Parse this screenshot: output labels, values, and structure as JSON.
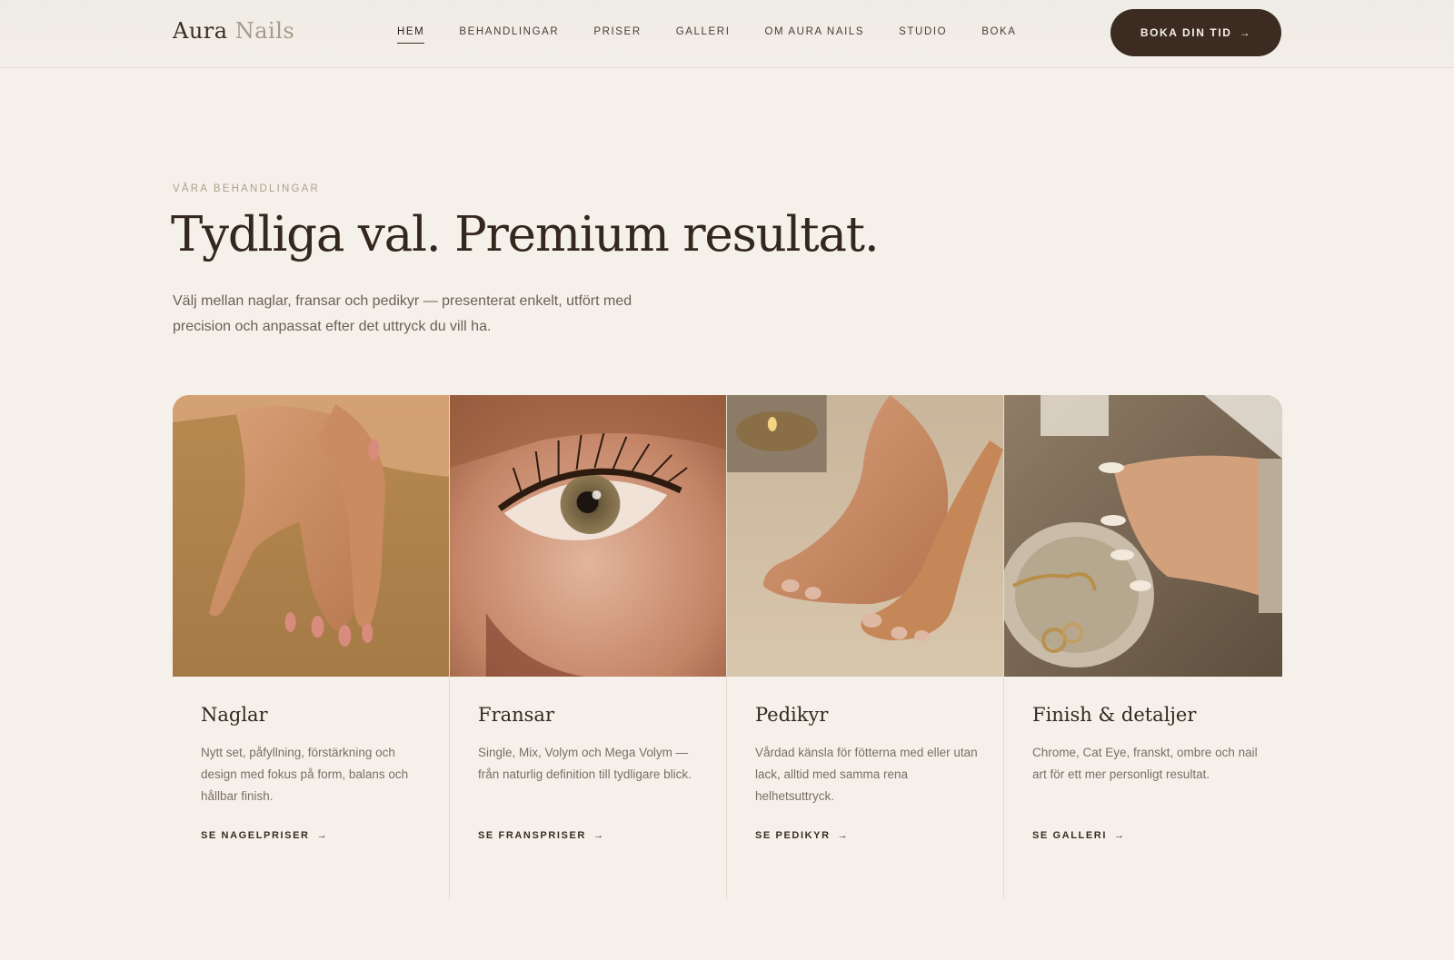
{
  "brand": {
    "name_primary": "Aura",
    "name_secondary": "Nails"
  },
  "nav": {
    "items": [
      {
        "label": "HEM",
        "active": true
      },
      {
        "label": "BEHANDLINGAR"
      },
      {
        "label": "PRISER"
      },
      {
        "label": "GALLERI"
      },
      {
        "label": "OM AURA NAILS"
      },
      {
        "label": "STUDIO"
      },
      {
        "label": "BOKA"
      }
    ],
    "cta_label": "BOKA DIN TID",
    "cta_arrow": "→"
  },
  "hero": {
    "eyebrow": "VÅRA BEHANDLINGAR",
    "title": "Tydliga val. Premium resultat.",
    "lead": "Välj mellan naglar, fransar och pedikyr — presenterat enkelt, utfört med precision och anpassat efter det uttryck du vill ha."
  },
  "cards": [
    {
      "title": "Naglar",
      "text": "Nytt set, påfyllning, förstärkning och design med fokus på form, balans och hållbar finish.",
      "link": "SE NAGELPRISER",
      "arrow": "→",
      "image": "hands-manicure-image"
    },
    {
      "title": "Fransar",
      "text": "Single, Mix, Volym och Mega Volym — från naturlig definition till tydligare blick.",
      "link": "SE FRANSPRISER",
      "arrow": "→",
      "image": "eye-lashes-image"
    },
    {
      "title": "Pedikyr",
      "text": "Vårdad känsla för fötterna med eller utan lack, alltid med samma rena helhetsuttryck.",
      "link": "SE PEDIKYR",
      "arrow": "→",
      "image": "feet-pedicure-image"
    },
    {
      "title": "Finish & detaljer",
      "text": "Chrome, Cat Eye, franskt, ombre och nail art för ett mer personligt resultat.",
      "link": "SE GALLERI",
      "arrow": "→",
      "image": "nail-art-jewelry-image"
    }
  ],
  "colors": {
    "background": "#f5f1ea",
    "text_dark": "#33271e",
    "cta_bg": "#3b2b20",
    "muted": "#b09e8c"
  }
}
